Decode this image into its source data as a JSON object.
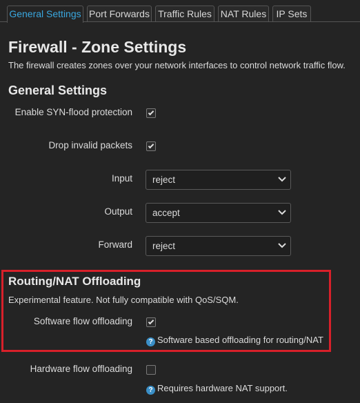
{
  "tabs": [
    {
      "label": "General Settings",
      "active": true
    },
    {
      "label": "Port Forwards",
      "active": false
    },
    {
      "label": "Traffic Rules",
      "active": false
    },
    {
      "label": "NAT Rules",
      "active": false
    },
    {
      "label": "IP Sets",
      "active": false
    }
  ],
  "page": {
    "title": "Firewall - Zone Settings",
    "description": "The firewall creates zones over your network interfaces to control network traffic flow."
  },
  "general": {
    "heading": "General Settings",
    "syn_flood_label": "Enable SYN-flood protection",
    "syn_flood_checked": true,
    "drop_invalid_label": "Drop invalid packets",
    "drop_invalid_checked": true,
    "input_label": "Input",
    "input_value": "reject",
    "output_label": "Output",
    "output_value": "accept",
    "forward_label": "Forward",
    "forward_value": "reject"
  },
  "offloading": {
    "heading": "Routing/NAT Offloading",
    "description": "Experimental feature. Not fully compatible with QoS/SQM.",
    "software_label": "Software flow offloading",
    "software_checked": true,
    "software_help": "Software based offloading for routing/NAT",
    "hardware_label": "Hardware flow offloading",
    "hardware_checked": false,
    "hardware_help": "Requires hardware NAT support."
  },
  "colors": {
    "accent": "#3aa7df",
    "highlight_box": "#d8202a",
    "background": "#242424"
  }
}
